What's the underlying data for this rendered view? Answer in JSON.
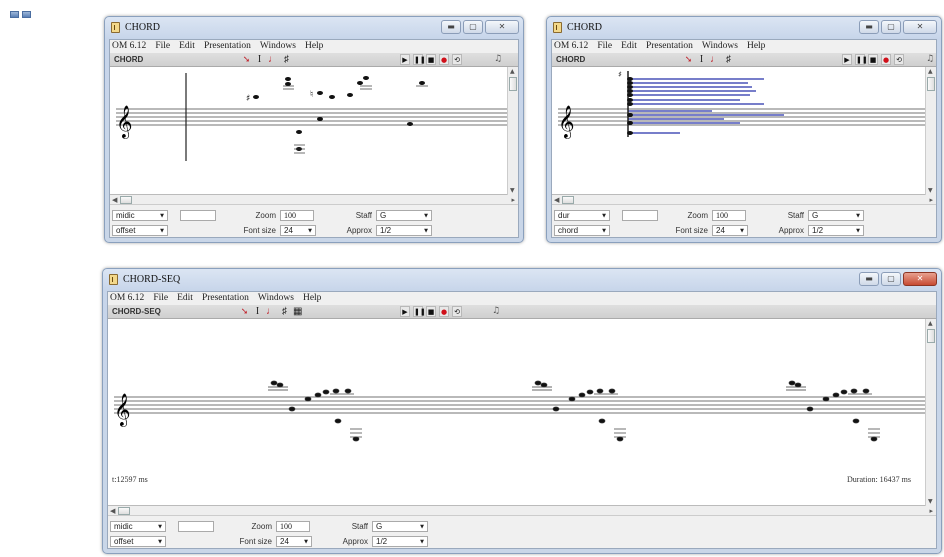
{
  "windows": [
    {
      "title": "CHORD",
      "menu": [
        "OM 6.12",
        "File",
        "Edit",
        "Presentation",
        "Windows",
        "Help"
      ],
      "toolbar_name": "CHORD",
      "controls": {
        "display_mode": "midic",
        "sub_mode": "offset",
        "zoom_label": "Zoom",
        "zoom_value": "100",
        "font_size_label": "Font size",
        "font_size_value": "24",
        "staff_label": "Staff",
        "staff_value": "G",
        "approx_label": "Approx",
        "approx_value": "1/2"
      }
    },
    {
      "title": "CHORD",
      "menu": [
        "OM 6.12",
        "File",
        "Edit",
        "Presentation",
        "Windows",
        "Help"
      ],
      "toolbar_name": "CHORD",
      "controls": {
        "display_mode": "dur",
        "sub_mode": "chord",
        "zoom_label": "Zoom",
        "zoom_value": "100",
        "font_size_label": "Font size",
        "font_size_value": "24",
        "staff_label": "Staff",
        "staff_value": "G",
        "approx_label": "Approx",
        "approx_value": "1/2"
      }
    },
    {
      "title": "CHORD-SEQ",
      "menu": [
        "OM 6.12",
        "File",
        "Edit",
        "Presentation",
        "Windows",
        "Help"
      ],
      "toolbar_name": "CHORD-SEQ",
      "time_readout": "t:12597 ms",
      "duration_readout": "Duration: 16437 ms",
      "controls": {
        "display_mode": "midic",
        "sub_mode": "offset",
        "zoom_label": "Zoom",
        "zoom_value": "100",
        "font_size_label": "Font size",
        "font_size_value": "24",
        "staff_label": "Staff",
        "staff_value": "G",
        "approx_label": "Approx",
        "approx_value": "1/2"
      }
    }
  ],
  "icons": {
    "clef": "treble-clef-icon",
    "arrow_tool": "arrow-cursor-icon",
    "text_tool": "text-cursor-icon",
    "play": "play-icon",
    "pause": "pause-icon",
    "stop": "stop-icon",
    "record": "record-icon",
    "loop": "loop-icon",
    "speaker": "speaker-icon"
  },
  "colors": {
    "window_frame": "#c7d5ea",
    "record": "#d0101a",
    "duration_bars": "#4a54b8",
    "close_button": "#c74a32"
  }
}
